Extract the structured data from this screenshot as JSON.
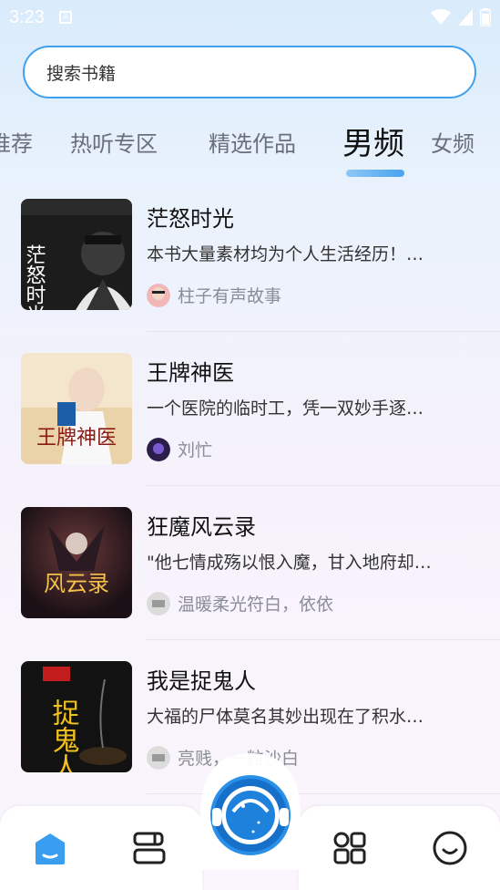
{
  "status_bar": {
    "time": "3:23",
    "notification_icon": "a-icon"
  },
  "search": {
    "placeholder": "搜索书籍"
  },
  "tabs": [
    {
      "label": "推荐"
    },
    {
      "label": "热听专区"
    },
    {
      "label": "精选作品"
    },
    {
      "label": "男频",
      "active": true
    },
    {
      "label": "女频"
    }
  ],
  "books": [
    {
      "title": "茫怒时光",
      "description": "本书大量素材均为个人生活经历！…",
      "author": "柱子有声故事",
      "cover_text": "茫怒时光",
      "cover_color": "#1c1c1c"
    },
    {
      "title": "王牌神医",
      "description": "一个医院的临时工，凭一双妙手逐…",
      "author": "刘忙",
      "cover_text": "王牌神医",
      "cover_color": "#e9cfa0"
    },
    {
      "title": "狂魔风云录",
      "description": "\"他七情成殇以恨入魔，甘入地府却…",
      "author": "温暖柔光符白，依依",
      "cover_text": "风云录",
      "cover_color": "#2a1b20"
    },
    {
      "title": "我是捉鬼人",
      "description": "大福的尸体莫名其妙出现在了积水…",
      "author": "亮贱，一粒沙白",
      "cover_text": "捉鬼人",
      "cover_color": "#121212"
    }
  ],
  "bottom_nav": [
    {
      "name": "home-icon"
    },
    {
      "name": "bookshelf-icon"
    },
    {
      "name": "player-button"
    },
    {
      "name": "category-grid-icon"
    },
    {
      "name": "profile-smile-icon"
    }
  ],
  "colors": {
    "accent": "#3ea1ef",
    "active_nav": "#3a9ef0"
  }
}
